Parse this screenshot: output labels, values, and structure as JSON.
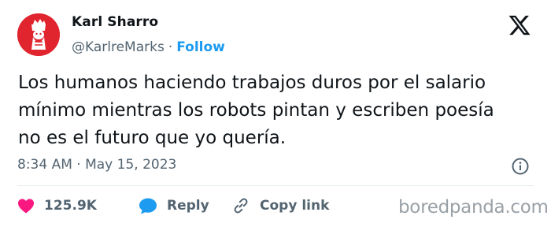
{
  "author": {
    "display_name": "Karl Sharro",
    "handle": "@KarlreMarks",
    "follow_label": "Follow",
    "separator": "·",
    "avatar_color": "#e0252f"
  },
  "tweet": {
    "text": "Los humanos haciendo trabajos duros por el salario\nmínimo mientras los robots pintan y escriben poesía\nno es el futuro que yo quería.",
    "timestamp": "8:34 AM · May 15, 2023"
  },
  "actions": {
    "likes_count": "125.9K",
    "reply_label": "Reply",
    "copy_link_label": "Copy link"
  },
  "icons": {
    "platform": "x-logo-icon",
    "info": "info-icon",
    "like": "heart-icon",
    "reply": "reply-bubble-icon",
    "copy_link": "link-icon"
  },
  "colors": {
    "accent": "#1d9bf0",
    "heart": "#f91880",
    "secondary_text": "#536471"
  },
  "watermark": "boredpanda.com"
}
